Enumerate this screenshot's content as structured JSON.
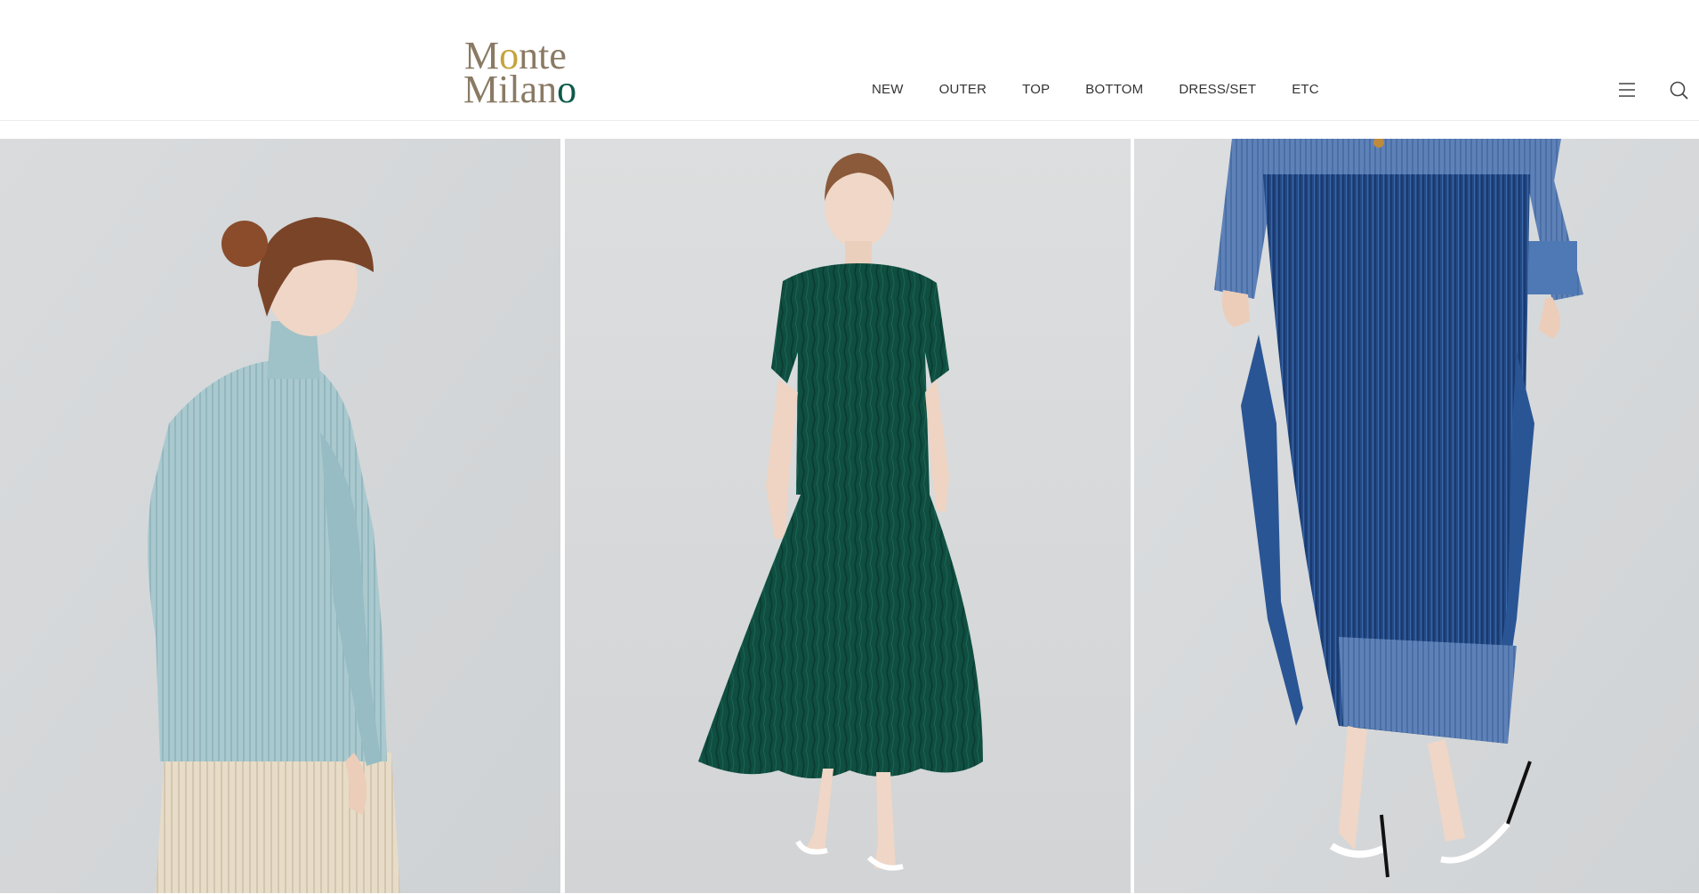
{
  "brand": {
    "line1_a": "M",
    "line1_o": "o",
    "line1_b": "nte",
    "line2_a": "Milan",
    "line2_o": "o"
  },
  "nav": {
    "items": [
      "NEW",
      "OUTER",
      "TOP",
      "BOTTOM",
      "DRESS/SET",
      "ETC"
    ]
  },
  "header_icons": [
    "menu-icon",
    "search-icon"
  ],
  "products": [
    {
      "alt": "Light blue pleated turtleneck top with beige pleated pants",
      "garment_color": "#a9c9cf"
    },
    {
      "alt": "Dark green crinkled short-sleeve top and pleated maxi skirt set",
      "garment_color": "#0f4e40"
    },
    {
      "alt": "Indigo pleated denim-print skirt with fringe trim",
      "garment_color": "#234a86"
    }
  ],
  "colors": {
    "logo_text": "#8a7a64",
    "logo_accent_gold": "#c5a43b",
    "logo_accent_green": "#0f5a4a",
    "photo_background": "#d7d9dc"
  }
}
